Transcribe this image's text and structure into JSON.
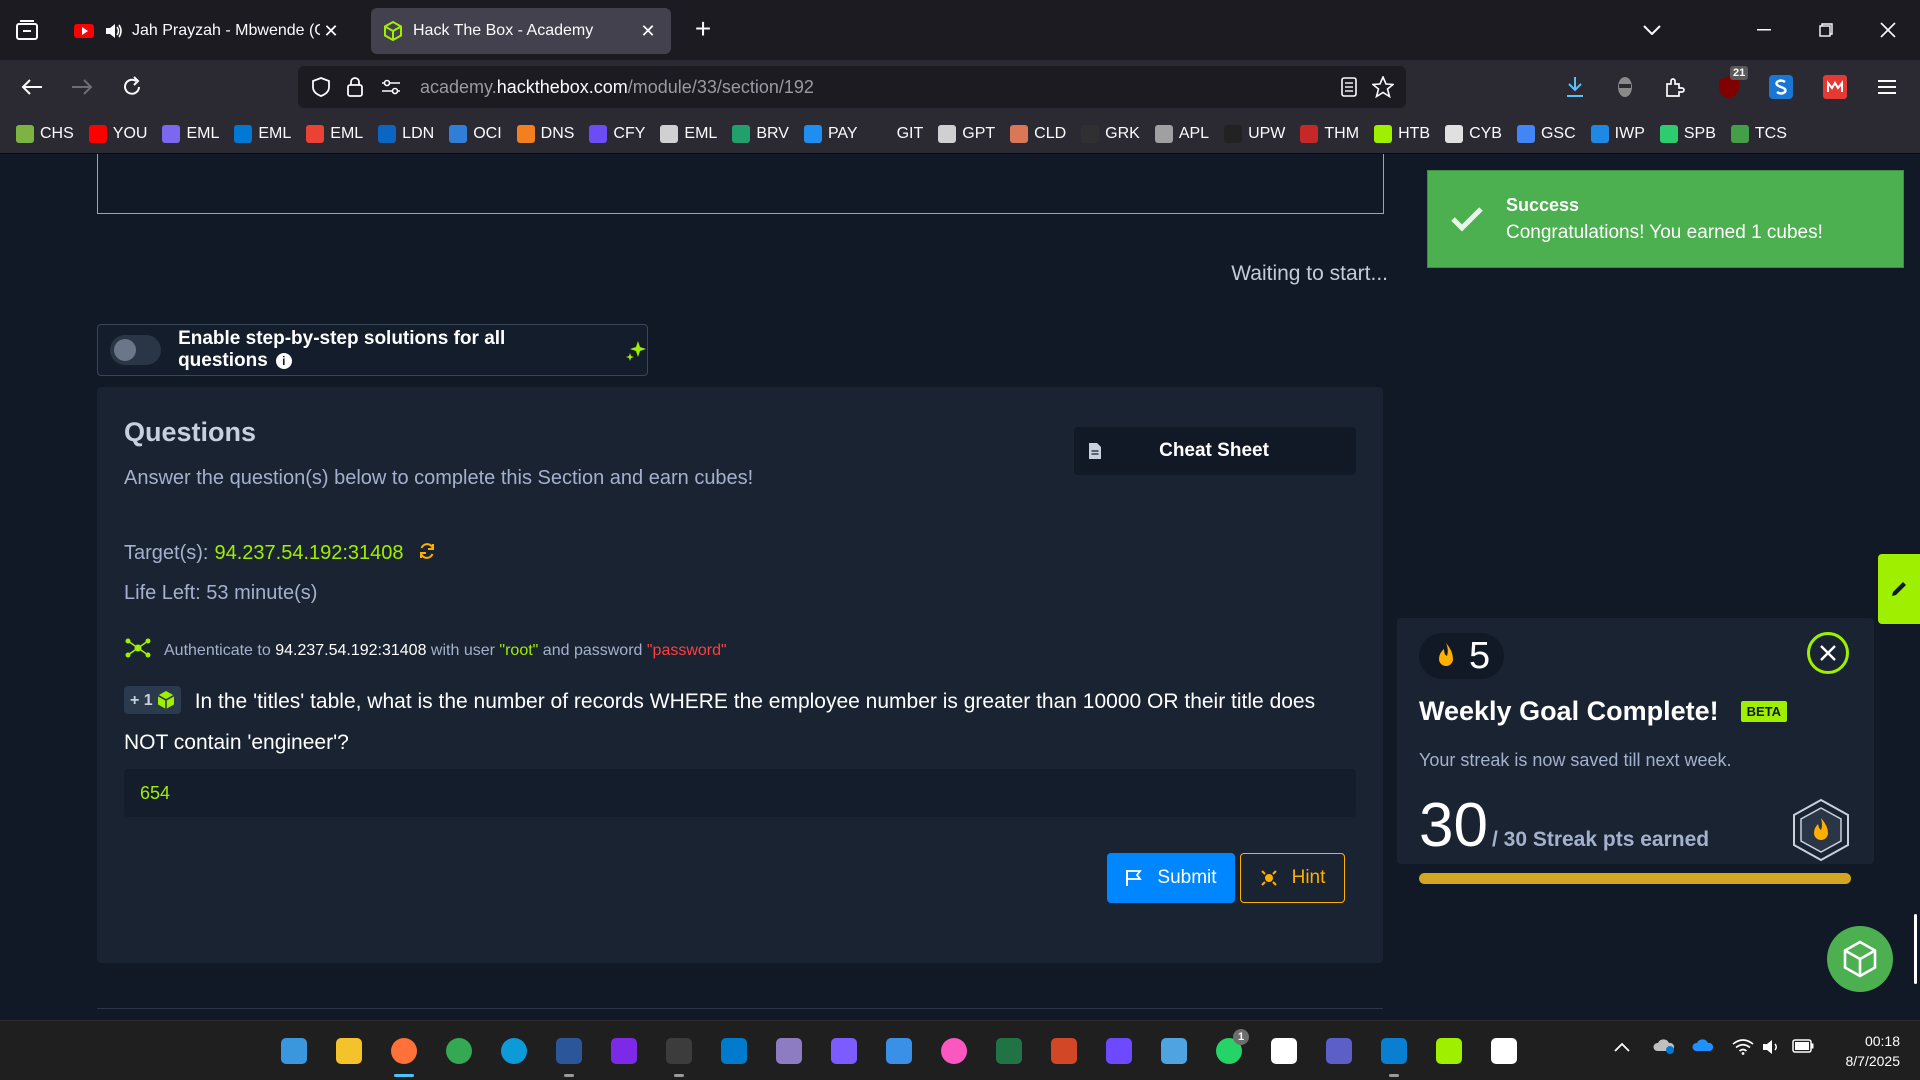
{
  "browser": {
    "tabs": [
      {
        "title": "Jah Prayzah - Mbwende (Gw",
        "active": false,
        "audio": true
      },
      {
        "title": "Hack The Box - Academy",
        "active": true
      }
    ],
    "new_tab_label": "+",
    "close_label": "✕",
    "url": {
      "prefix": "academy.",
      "domain": "hackthebox.com",
      "path": "/module/33/section/192"
    },
    "extensions_badge": "21",
    "bookmarks": [
      {
        "label": "CHS",
        "color": "#7cb342"
      },
      {
        "label": "YOU",
        "color": "#ff0000"
      },
      {
        "label": "EML",
        "color": "#7b68ee"
      },
      {
        "label": "EML",
        "color": "#0078d4"
      },
      {
        "label": "EML",
        "color": "#ea4335"
      },
      {
        "label": "LDN",
        "color": "#0a66c2"
      },
      {
        "label": "OCI",
        "color": "#2f7ed8"
      },
      {
        "label": "DNS",
        "color": "#f38020"
      },
      {
        "label": "CFY",
        "color": "#6c4cf5"
      },
      {
        "label": "EML",
        "color": "#d0d0d0"
      },
      {
        "label": "BRV",
        "color": "#22a06b"
      },
      {
        "label": "PAY",
        "color": "#1f8ef1"
      },
      {
        "label": "GIT",
        "color": "#2b2a33"
      },
      {
        "label": "GPT",
        "color": "#d0d0d0"
      },
      {
        "label": "CLD",
        "color": "#d97757"
      },
      {
        "label": "GRK",
        "color": "#303030"
      },
      {
        "label": "APL",
        "color": "#a0a0a0"
      },
      {
        "label": "UPW",
        "color": "#222222"
      },
      {
        "label": "THM",
        "color": "#c62828"
      },
      {
        "label": "HTB",
        "color": "#9fef00"
      },
      {
        "label": "CYB",
        "color": "#e0e0e0"
      },
      {
        "label": "GSC",
        "color": "#4285f4"
      },
      {
        "label": "IWP",
        "color": "#1e88e5"
      },
      {
        "label": "SPB",
        "color": "#2ecc71"
      },
      {
        "label": "TCS",
        "color": "#43a047"
      }
    ]
  },
  "page": {
    "waiting_text": "Waiting to start...",
    "step_toggle_label": "Enable step-by-step solutions for all questions",
    "step_info_glyph": "i",
    "questions": {
      "title": "Questions",
      "subtitle": "Answer the question(s) below to complete this Section and earn cubes!",
      "cheat_sheet_label": "Cheat Sheet",
      "target_label": "Target(s):",
      "target_value": "94.237.54.192:31408",
      "life_left": "Life Left: 53 minute(s)",
      "auth": {
        "pre": "Authenticate to",
        "host": "94.237.54.192:31408",
        "mid": "with user",
        "user": "\"root\"",
        "and": "and password",
        "password": "\"password\""
      },
      "cube_reward": "+ 1",
      "question_text": "In the 'titles' table, what is the number of records WHERE the employee number is greater than 10000 OR their title does NOT contain 'engineer'?",
      "answer_value": "654",
      "submit_label": "Submit",
      "hint_label": "Hint"
    }
  },
  "toast": {
    "title": "Success",
    "message": "Congratulations! You earned 1 cubes!",
    "color": "#4caf50"
  },
  "weekly_goal": {
    "streak_count": "5",
    "title": "Weekly Goal Complete!",
    "beta_label": "BETA",
    "subtitle": "Your streak is now saved till next week.",
    "points": "30",
    "points_suffix": "/ 30 Streak pts earned",
    "progress_fraction": 1.0
  },
  "taskbar": {
    "apps": [
      {
        "name": "windows-start",
        "color": "#3a96dd"
      },
      {
        "name": "file-explorer",
        "color": "#f4c22b"
      },
      {
        "name": "firefox",
        "color": "#ff7139"
      },
      {
        "name": "chrome",
        "color": "#34a853"
      },
      {
        "name": "edge",
        "color": "#0c9bd8"
      },
      {
        "name": "word",
        "color": "#2b579a"
      },
      {
        "name": "canva",
        "color": "#7d2ae8"
      },
      {
        "name": "terminal",
        "color": "#3c3c3c"
      },
      {
        "name": "vscode",
        "color": "#007acc"
      },
      {
        "name": "app-purple",
        "color": "#8e7cc3"
      },
      {
        "name": "obsidian",
        "color": "#7c5cff"
      },
      {
        "name": "ms-store",
        "color": "#3a8fe6"
      },
      {
        "name": "itunes",
        "color": "#fa57c1"
      },
      {
        "name": "excel",
        "color": "#217346"
      },
      {
        "name": "powerpoint",
        "color": "#d24726"
      },
      {
        "name": "protonvpn",
        "color": "#6d4aff"
      },
      {
        "name": "notepad",
        "color": "#4fa3e0"
      },
      {
        "name": "whatsapp",
        "color": "#25d366"
      },
      {
        "name": "capcut",
        "color": "#ffffff"
      },
      {
        "name": "teams",
        "color": "#5b5fc7"
      },
      {
        "name": "remote-desktop",
        "color": "#0a7fd1"
      },
      {
        "name": "htb-app",
        "color": "#9fef00"
      },
      {
        "name": "notion",
        "color": "#ffffff"
      }
    ],
    "whatsapp_badge": "1",
    "time": "00:18",
    "date": "8/7/2025"
  }
}
